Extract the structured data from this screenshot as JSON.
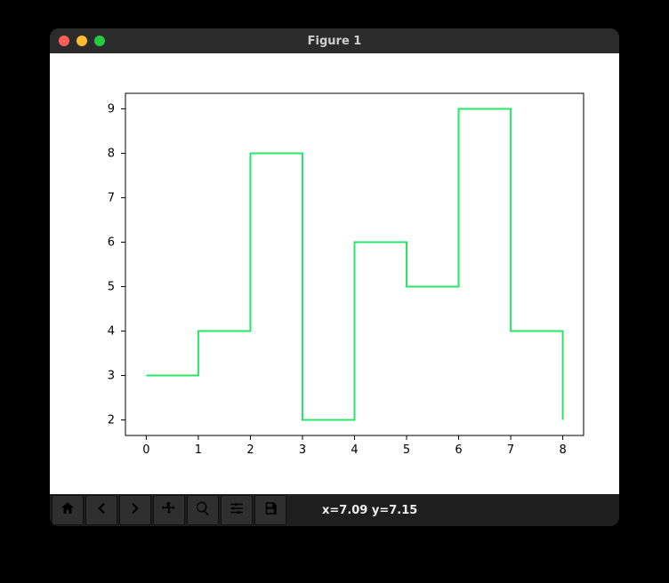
{
  "window": {
    "title": "Figure 1"
  },
  "toolbar": {
    "home": "Home",
    "back": "Back",
    "forward": "Forward",
    "pan": "Pan",
    "zoom": "Zoom",
    "configure": "Configure subplots",
    "save": "Save"
  },
  "status": {
    "text": "x=7.09 y=7.15"
  },
  "chart_data": {
    "type": "line",
    "step": "post",
    "x": [
      0,
      1,
      2,
      3,
      4,
      5,
      6,
      7,
      8
    ],
    "y": [
      3,
      4,
      8,
      2,
      6,
      5,
      9,
      4,
      2
    ],
    "line_color": "#28e66a",
    "xticks": [
      0,
      1,
      2,
      3,
      4,
      5,
      6,
      7,
      8
    ],
    "yticks": [
      2,
      3,
      4,
      5,
      6,
      7,
      8,
      9
    ],
    "xlim": [
      -0.4,
      8.4
    ],
    "ylim": [
      1.65,
      9.35
    ],
    "title": "",
    "xlabel": "",
    "ylabel": ""
  }
}
